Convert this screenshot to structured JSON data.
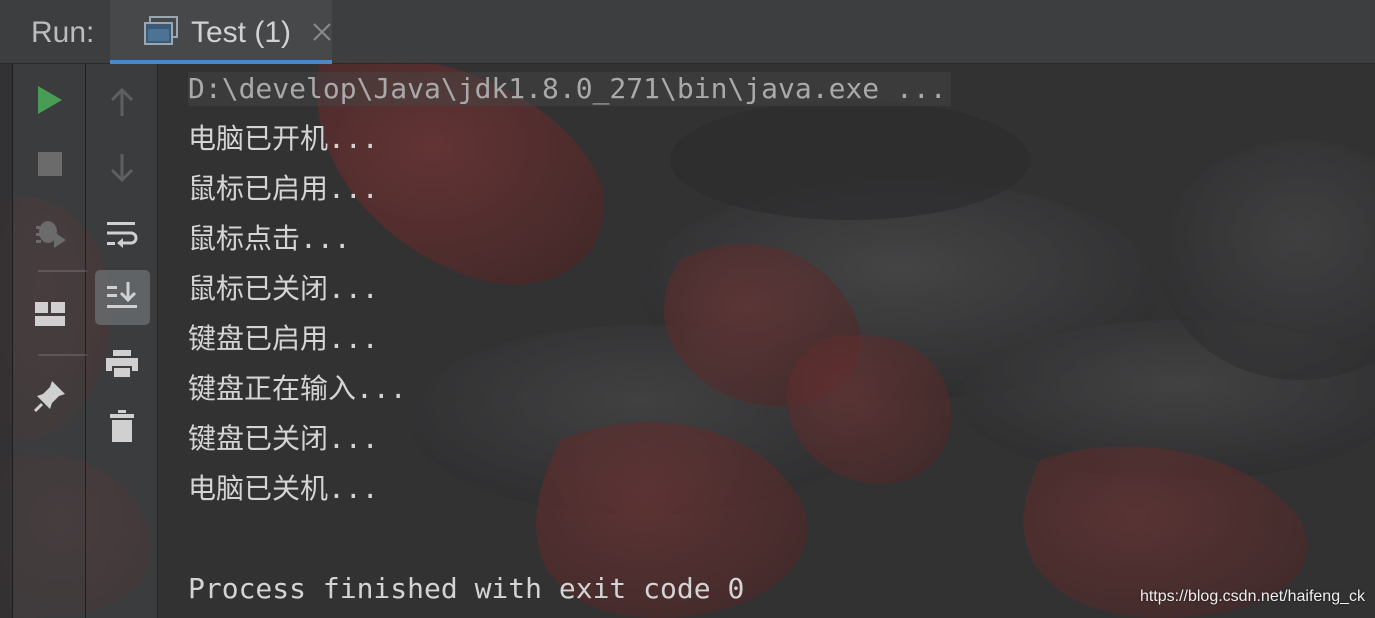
{
  "run_bar": {
    "label": "Run:",
    "tab_title": "Test (1)",
    "tab_icon": "console-window-icon",
    "close_icon": "close-icon"
  },
  "left_toolbar": {
    "buttons": [
      {
        "name": "rerun-button",
        "icon": "play-icon",
        "color": "#499c54"
      },
      {
        "name": "stop-button",
        "icon": "stop-icon",
        "color": "#6e6e6e"
      },
      {
        "name": "debug-button",
        "icon": "bug-icon",
        "color": "#6e6e6e"
      },
      {
        "name": "restore-layout-button",
        "icon": "layout-icon",
        "color": "#d8d8d8"
      },
      {
        "name": "pin-tab-button",
        "icon": "pin-icon",
        "color": "#d8d8d8"
      }
    ]
  },
  "console_toolbar": {
    "buttons": [
      {
        "name": "up-stack-trace-button",
        "icon": "arrow-up-icon"
      },
      {
        "name": "down-stack-trace-button",
        "icon": "arrow-down-icon"
      },
      {
        "name": "soft-wrap-button",
        "icon": "soft-wrap-icon"
      },
      {
        "name": "scroll-to-end-button",
        "icon": "scroll-to-end-icon",
        "active": true
      },
      {
        "name": "print-button",
        "icon": "printer-icon"
      },
      {
        "name": "clear-all-button",
        "icon": "trash-icon"
      }
    ]
  },
  "console": {
    "command": "D:\\develop\\Java\\jdk1.8.0_271\\bin\\java.exe ...",
    "lines": [
      "电脑已开机...",
      "鼠标已启用...",
      "鼠标点击...",
      "鼠标已关闭...",
      "键盘已启用...",
      "键盘正在输入...",
      "键盘已关闭...",
      "电脑已关机..."
    ],
    "exit_message": "Process finished with exit code 0"
  },
  "watermark": "https://blog.csdn.net/haifeng_ck",
  "colors": {
    "accent": "#4a88c7",
    "run_green": "#499c54",
    "console_text": "#d4d4d4"
  }
}
